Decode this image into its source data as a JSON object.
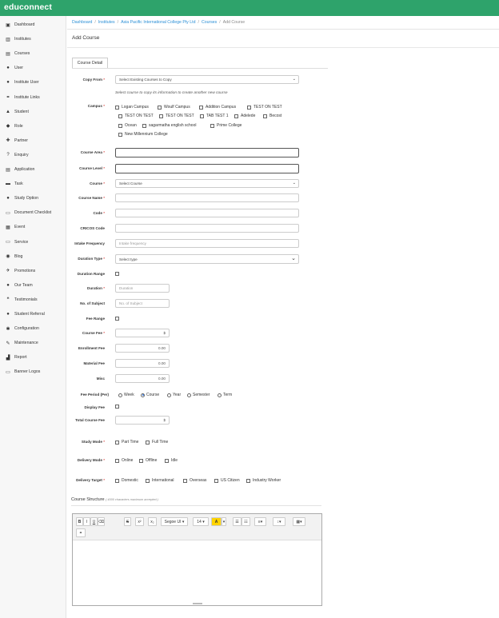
{
  "app": {
    "logo": "educonnect"
  },
  "sidebar": {
    "items": [
      {
        "label": "Dashboard",
        "icon": "▣"
      },
      {
        "label": "Institutes",
        "icon": "▥"
      },
      {
        "label": "Courses",
        "icon": "▤"
      },
      {
        "label": "User",
        "icon": "●"
      },
      {
        "label": "Institute User",
        "icon": "●"
      },
      {
        "label": "Institute Links",
        "icon": "⚭"
      },
      {
        "label": "Student",
        "icon": "▲"
      },
      {
        "label": "Role",
        "icon": "◆"
      },
      {
        "label": "Partner",
        "icon": "✚"
      },
      {
        "label": "Enquiry",
        "icon": "?"
      },
      {
        "label": "Application",
        "icon": "▤"
      },
      {
        "label": "Task",
        "icon": "▬"
      },
      {
        "label": "Study Option",
        "icon": "●"
      },
      {
        "label": "Document Checklist",
        "icon": "▭"
      },
      {
        "label": "Event",
        "icon": "▦"
      },
      {
        "label": "Service",
        "icon": "▭"
      },
      {
        "label": "Blog",
        "icon": "◉"
      },
      {
        "label": "Promotions",
        "icon": "✈"
      },
      {
        "label": "Our Team",
        "icon": "●"
      },
      {
        "label": "Testimonials",
        "icon": "❝"
      },
      {
        "label": "Student Referral",
        "icon": "●"
      },
      {
        "label": "Configuration",
        "icon": "✱"
      },
      {
        "label": "Maintenance",
        "icon": "✎"
      },
      {
        "label": "Report",
        "icon": "▟"
      },
      {
        "label": "Banner Logos",
        "icon": "▭"
      }
    ]
  },
  "breadcrumb": [
    "Dashboard",
    "Institutes",
    "Asia Pacific International College Pty Ltd",
    "Courses",
    "Add Course"
  ],
  "page": {
    "title": "Add Course",
    "tab": "Course Detail"
  },
  "form": {
    "copy_from": {
      "label": "Copy From",
      "value": "Select Existing Courses to Copy",
      "hint": "Select course to copy its information to create another new course"
    },
    "campus": {
      "label": "Campus",
      "options": [
        "Logan Campus",
        "Woulf Campus",
        "Addition Campus",
        "TEST ON TEST",
        "TEST ON TEST",
        "TEST ON TEST",
        "TAB TEST 1",
        "Adelede",
        "Becost",
        "Ocean",
        "sagarmatha english school",
        "Prime College",
        "New Millennium College"
      ]
    },
    "course_area": {
      "label": "Course Area"
    },
    "course_level": {
      "label": "Course Level"
    },
    "course": {
      "label": "Course",
      "value": "Select Course"
    },
    "course_name": {
      "label": "Course Name"
    },
    "code": {
      "label": "Code"
    },
    "cricos": {
      "label": "CRICOS Code"
    },
    "intake": {
      "label": "Intake Frequency",
      "placeholder": "Intake frequency"
    },
    "duration_type": {
      "label": "Duration Type",
      "value": "Select type"
    },
    "duration_range": {
      "label": "Duration Range"
    },
    "duration": {
      "label": "Duration",
      "placeholder": "Duration"
    },
    "subjects": {
      "label": "No. of Subject",
      "placeholder": "No. of Subject"
    },
    "fee_range": {
      "label": "Fee Range"
    },
    "course_fee": {
      "label": "Course Fee",
      "value": "$"
    },
    "enrollment_fee": {
      "label": "Enrollment Fee",
      "value": "0.00"
    },
    "material_fee": {
      "label": "Material Fee",
      "value": "0.00"
    },
    "misc": {
      "label": "Misc",
      "value": "0.00"
    },
    "fee_period": {
      "label": "Fee Period (Per)",
      "options": [
        "Week",
        "Course",
        "Year",
        "Semester",
        "Term"
      ],
      "selected": "Course"
    },
    "display_fee": {
      "label": "Display Fee"
    },
    "total_fee": {
      "label": "Total Course Fee",
      "value": "$"
    },
    "study_mode": {
      "label": "Study Mode",
      "options": [
        "Part Time",
        "Full Time"
      ]
    },
    "delivery_mode": {
      "label": "Delivery Mode",
      "options": [
        "Online",
        "Offline",
        "Idle"
      ]
    },
    "delivery_target": {
      "label": "Delivery Target",
      "options": [
        "Domestic",
        "International",
        "Overseas",
        "US Citizen",
        "Industry Worker"
      ]
    }
  },
  "structure": {
    "title": "Course Structure",
    "note": "( 4000 characters maximum accepted )",
    "toolbar": {
      "bold": "B",
      "italic": "I",
      "underline": "U",
      "eraser": "⌫",
      "strike": "S",
      "superscript": "x²",
      "subscript": "x₂",
      "font": "Segoe UI",
      "size": "14",
      "color": "A",
      "ul": "☰",
      "ol": "☷",
      "align": "≡",
      "line_height": "↕",
      "table": "▦",
      "link": "⚭"
    }
  }
}
